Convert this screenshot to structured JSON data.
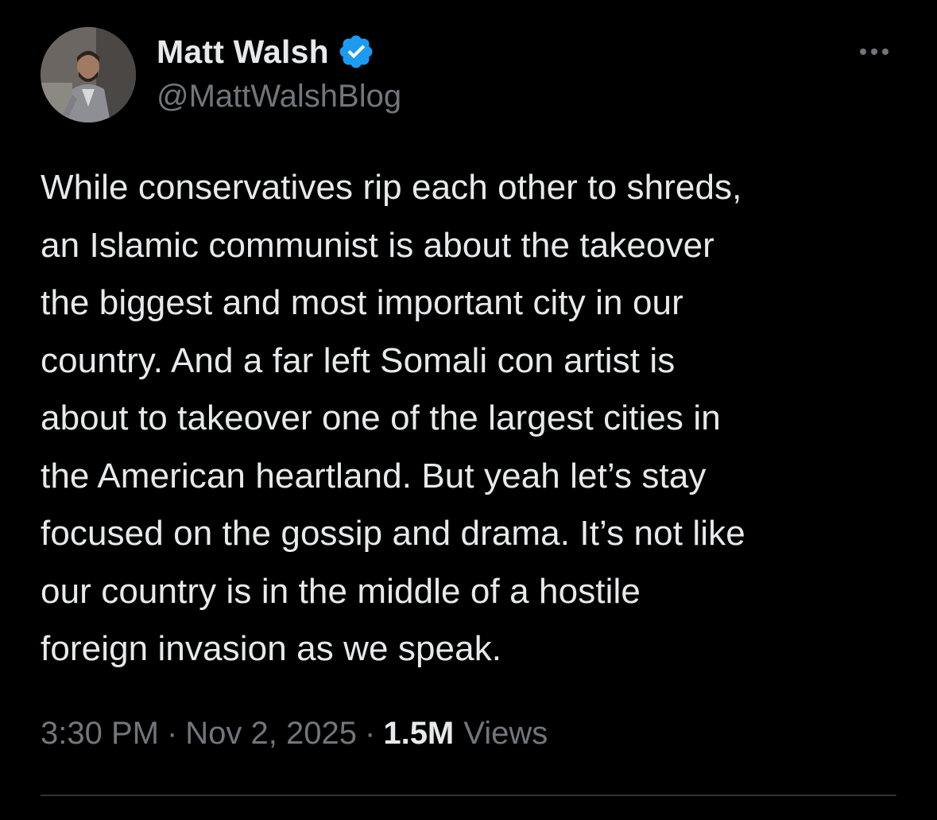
{
  "author": {
    "name": "Matt Walsh",
    "handle": "@MattWalshBlog",
    "verified_icon": "verified-badge-icon",
    "avatar_icon": "profile-photo"
  },
  "tweet": {
    "lines": [
      "While conservatives rip each other to shreds,",
      "an Islamic communist is about the takeover",
      "the biggest and most important city in our",
      "country. And a far left Somali con artist is",
      "about to takeover one of the largest cities in",
      "the American heartland. But yeah let’s stay",
      "focused on the gossip and drama. It’s not like",
      "our country is in the middle of a hostile",
      "foreign invasion as we speak."
    ]
  },
  "meta": {
    "time": "3:30 PM",
    "separator": "·",
    "date": "Nov 2, 2025",
    "views_count": "1.5M",
    "views_label": "Views"
  },
  "colors": {
    "background": "#000000",
    "primary_text": "#e7e9ea",
    "secondary_text": "#71767b",
    "verified_blue": "#1d9bf0",
    "divider": "#2f3336"
  }
}
